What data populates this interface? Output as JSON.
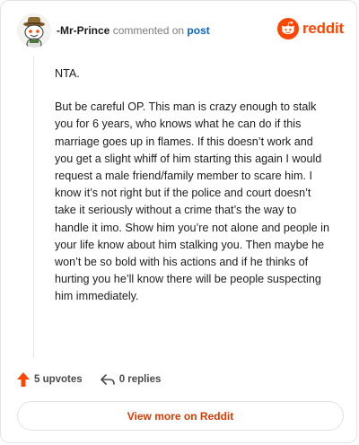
{
  "comment": {
    "author": "-Mr-Prince",
    "action_text": "commented on",
    "target_link": "post",
    "paragraphs": [
      "NTA.",
      "But be careful OP. This man is crazy enough to stalk you for 6 years, who knows what he can do if this marriage goes up in flames. If this doesn’t work and you get a slight whiff of him starting this again I would request a male friend/family member to scare him. I know it’s not right but if the police and court doesn’t take it seriously without a crime that’s the way to handle it imo. Show him you’re not alone and people in your life know about him stalking you. Then maybe he won’t be so bold with his actions and if he thinks of hurting you he’ll know there will be people suspecting him immediately."
    ]
  },
  "brand": {
    "name": "reddit",
    "color": "#ff4500"
  },
  "actions": {
    "upvotes": "5 upvotes",
    "replies": "0 replies"
  },
  "footer": {
    "view_more": "View more on Reddit"
  },
  "colors": {
    "accent_orange": "#ff4500",
    "link_blue": "#0a66c2",
    "view_more_text": "#d93a00"
  },
  "icons": {
    "avatar": "snoo-avatar-with-hat",
    "brand": "reddit-snoo-logo-icon",
    "upvote": "upvote-arrow-icon",
    "reply": "reply-arrow-icon"
  }
}
